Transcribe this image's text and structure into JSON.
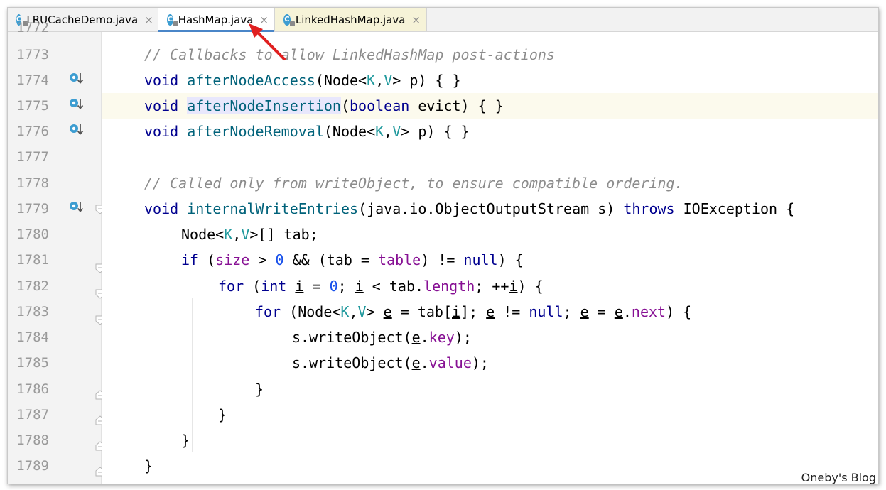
{
  "tabs": [
    {
      "label": "LRUCacheDemo.java",
      "icon": "class-icon",
      "close": "×"
    },
    {
      "label": "HashMap.java",
      "icon": "class-icon",
      "close": "×"
    },
    {
      "label": "LinkedHashMap.java",
      "icon": "class-icon",
      "close": "×"
    }
  ],
  "tab_icon_letter": "C",
  "partial_line_number": "1772",
  "line_numbers": [
    "1773",
    "1774",
    "1775",
    "1776",
    "1777",
    "1778",
    "1779",
    "1780",
    "1781",
    "1782",
    "1783",
    "1784",
    "1785",
    "1786",
    "1787",
    "1788",
    "1789"
  ],
  "code": {
    "l1773": {
      "comment": "// Callbacks to allow LinkedHashMap post-actions"
    },
    "l1774": {
      "kw": "void",
      "name": "afterNodeAccess",
      "p1": "(Node<",
      "k": "K",
      "c": ",",
      "v": "V",
      "p2": "> p) { }"
    },
    "l1775": {
      "kw": "void",
      "name": "afterNodeInsertion",
      "p1": "(",
      "kw2": "boolean",
      "p2": " evict) { }"
    },
    "l1776": {
      "kw": "void",
      "name": "afterNodeRemoval",
      "p1": "(Node<",
      "k": "K",
      "c": ",",
      "v": "V",
      "p2": "> p) { }"
    },
    "l1778": {
      "comment": "// Called only from writeObject, to ensure compatible ordering."
    },
    "l1779": {
      "kw": "void",
      "name": "internalWriteEntries",
      "p1": "(java.io.ObjectOutputStream s) ",
      "kw2": "throws",
      "p2": " IOException {"
    },
    "l1780": {
      "p1": "Node<",
      "k": "K",
      "c": ",",
      "v": "V",
      "p2": ">[] tab;"
    },
    "l1781": {
      "kw": "if",
      "p1": " (",
      "f1": "size",
      "p2": " > ",
      "n": "0",
      "p3": " && (tab = ",
      "f2": "table",
      "p4": ") != ",
      "kw2": "null",
      "p5": ") {"
    },
    "l1782": {
      "kw": "for",
      "p1": " (",
      "kw2": "int",
      "sp": " ",
      "i1": "i",
      "p2": " = ",
      "n": "0",
      "p3": "; ",
      "i2": "i",
      "p4": " < tab.",
      "f": "length",
      "p5": "; ++",
      "i3": "i",
      "p6": ") {"
    },
    "l1783": {
      "kw": "for",
      "p1": " (Node<",
      "k": "K",
      "c": ",",
      "v": "V",
      "p2": "> ",
      "e1": "e",
      "p3": " = tab[",
      "i": "i",
      "p4": "]; ",
      "e2": "e",
      "p5": " != ",
      "kw2": "null",
      "p6": "; ",
      "e3": "e",
      "p7": " = ",
      "e4": "e",
      "p8": ".",
      "f": "next",
      "p9": ") {"
    },
    "l1784": {
      "p1": "s.writeObject(",
      "e": "e",
      "p2": ".",
      "f": "key",
      "p3": ");"
    },
    "l1785": {
      "p1": "s.writeObject(",
      "e": "e",
      "p2": ".",
      "f": "value",
      "p3": ");"
    },
    "l1786": {
      "t": "}"
    },
    "l1787": {
      "t": "}"
    },
    "l1788": {
      "t": "}"
    },
    "l1789": {
      "t": "}"
    }
  },
  "watermark": "Oneby's Blog",
  "colors": {
    "keyword": "#00008f",
    "method": "#00627a",
    "type_param": "#20999d",
    "field": "#871094",
    "number": "#1750eb",
    "comment": "#8c8c8c",
    "active_tab": "#4a86c8",
    "arrow": "#e02020"
  }
}
